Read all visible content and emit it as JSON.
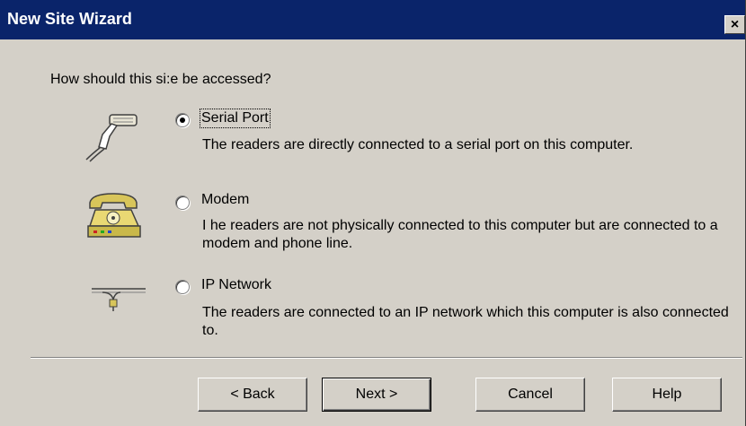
{
  "window": {
    "title": "New Site Wizard",
    "close_glyph": "×"
  },
  "question": "How should this si:e be accessed?",
  "options": [
    {
      "label": "Serial Port",
      "description": "The readers are directly connected to a serial port on this computer.",
      "selected": true,
      "icon": "serial-cable-icon"
    },
    {
      "label": "Modem",
      "description": "I he readers are not physically connected to this computer but are connected to a modem and phone line.",
      "selected": false,
      "icon": "telephone-modem-icon"
    },
    {
      "label": "IP Network",
      "description": "The readers are connected to an IP network which this computer is also connected to.",
      "selected": false,
      "icon": "network-connector-icon"
    }
  ],
  "buttons": {
    "back": "< Back",
    "next": "Next >",
    "cancel": "Cancel",
    "help": "Help"
  },
  "colors": {
    "titlebar": "#0a246a",
    "face": "#d4d0c8"
  }
}
